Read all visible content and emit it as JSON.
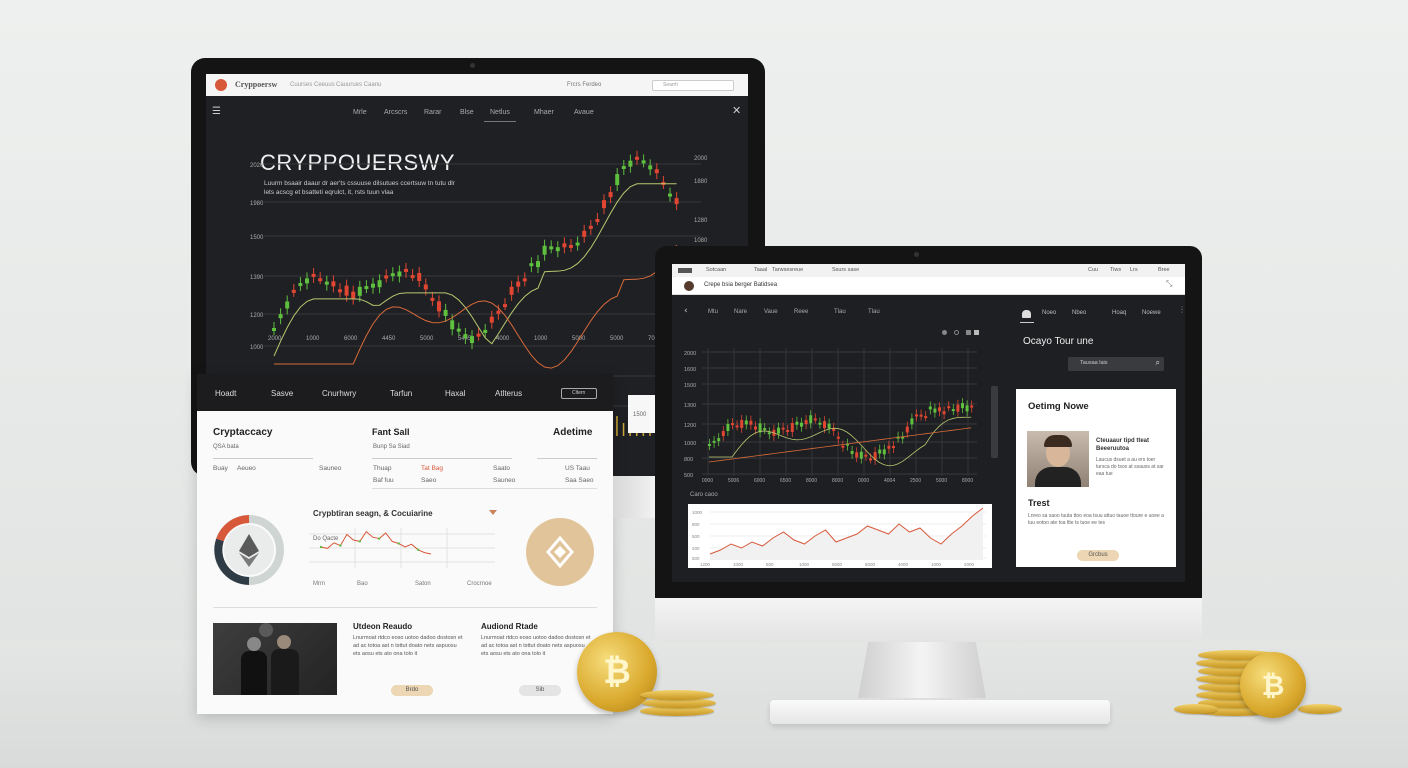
{
  "big_monitor": {
    "brand": "Cryppoersw",
    "topbar_links": [
      "Cuurses Ceeuus",
      "Cauurues Caanu"
    ],
    "topbar_right": "Frcrs Ferdeo",
    "search_placeholder": "Searrh",
    "nav": [
      "Mrle",
      "Arcscrs",
      "Rarar",
      "Blse",
      "Netlus",
      "Mhaer",
      "Avaue"
    ],
    "hero_title": "CRYPPOUERSWY",
    "hero_text": "Luurm bsaair daaur dr aer'ts cssuuse dilsutues ccertsuw tn tutu dlr lets acscg et bsatteti eqrulct, it, rsts tuun vlaa",
    "y_ticks": [
      "2020",
      "1980",
      "1500",
      "1390",
      "1200",
      "1000",
      "800",
      "500"
    ],
    "y_ticks_right": [
      "2000",
      "1880",
      "1280",
      "1080"
    ],
    "x_ticks": [
      "2000",
      "1000",
      "6000",
      "4450",
      "5000",
      "5445",
      "4000",
      "1000",
      "5000",
      "5000",
      "7000"
    ],
    "side_label": "1500"
  },
  "tablet": {
    "nav": [
      "Hoadt",
      "Sasve",
      "Cnurhwry",
      "Tarfun",
      "Haxal",
      "Atlterus"
    ],
    "nav_button": "Cltern",
    "sections": [
      {
        "title": "Cryptaccacy",
        "sub": "QSA bata"
      },
      {
        "title": "Fant Sall",
        "sub": "Bunp Sa Siad"
      },
      {
        "title": "Adetime",
        "sub": ""
      }
    ],
    "table": {
      "rows": [
        [
          "Buay",
          "Aeueo",
          "Sauneo",
          "Thuap",
          "Tat Bag",
          "Saato",
          "US Taau"
        ],
        [
          "",
          "",
          "",
          "Baf fuu",
          "Saeo",
          "Sauneo",
          "Saa Saeo"
        ]
      ]
    },
    "mid_title": "Crypbtiran seagn, & Cocuiarine",
    "mid_chart_label": "Do Qacte",
    "mid_x_ticks": [
      "Mrm",
      "Bao",
      "Saton",
      "Crocrnoe"
    ],
    "bottom_left_title": "Utdeon Reaudo",
    "bottom_right_title": "Audiond Rtade",
    "bottom_text": "Lnurmoat rtdco eoso uotoo dadoo dostosn et ad ac totoa ast n tsttut doato nets aspuosu ets aosu ets ato ona tolo it",
    "btn_left": "Brdo",
    "btn_right": "Sib",
    "chart_data": {
      "type": "line",
      "values": [
        30,
        28,
        36,
        32,
        48,
        40,
        38,
        52,
        44,
        42,
        50,
        38,
        35,
        30,
        34,
        26,
        22,
        20
      ]
    }
  },
  "right_monitor": {
    "status_links": [
      "Sotcaan",
      "Taaal",
      "Tarwsesreue",
      "Ssurs sase"
    ],
    "status_right": [
      "Cuu",
      "Tiws",
      "Lrs",
      "Bree"
    ],
    "title_bar": "Crepe bsia berger Batidsea",
    "chart_links": [
      "Mtu",
      "Nare",
      "Vaue",
      "Reee",
      "Tlau",
      "Tlau"
    ],
    "y_ticks": [
      "2000",
      "1600",
      "1500",
      "1300",
      "1200",
      "1000",
      "800",
      "500"
    ],
    "x_ticks": [
      "0000",
      "5006",
      "6000",
      "6500",
      "8000",
      "8000",
      "0000",
      "4004",
      "2500",
      "5000",
      "8000"
    ],
    "sub_chart_label": "Caro caoo",
    "sub_y_ticks": [
      "1000",
      "800",
      "500",
      "200",
      "500"
    ],
    "sub_x_ticks": [
      "1200",
      "1000",
      "500",
      "1000",
      "5000",
      "5000",
      "4000",
      "1000",
      "2000"
    ],
    "sidebar_nav": [
      "Noeo",
      "Nbeo",
      "Hoaq",
      "Noewe"
    ],
    "sidebar_title": "Ocayo Tour une",
    "sidebar_search": "Tausaa lais",
    "card_title": "Oetimg Nowe",
    "card_person_title": "Cteuaaur tipd tteat Beeeruutoa",
    "card_person_text": "Laucus dsuet a au ers toer tursca do tsos at ssauos at sar eaa tue",
    "card_trust": "Trest",
    "card_text": "Lnreo sa saoo tuuta ttoo eoa tsuu attuo tauoe ttoure e uoee a tuu eotoo ate toa ltte ts tuoe ee tes",
    "card_button": "Grcbus"
  },
  "colors": {
    "up": "#5fbf3f",
    "down": "#e04632",
    "accent": "#e1c7a0",
    "ma": "#b8c870",
    "ma2": "#d96b3a"
  }
}
